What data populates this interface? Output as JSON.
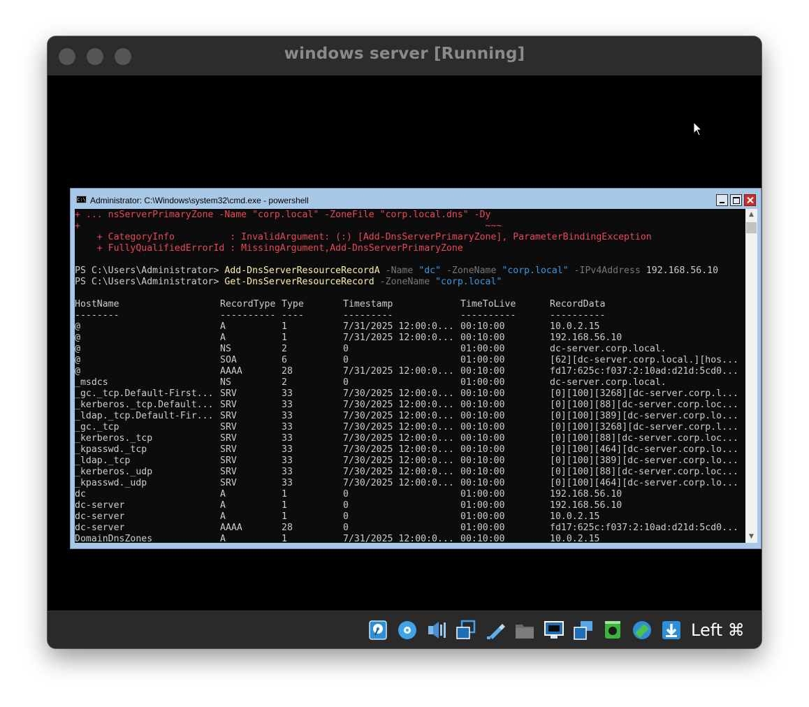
{
  "window": {
    "title": "windows server [Running]"
  },
  "cmd": {
    "title": "Administrator: C:\\Windows\\system32\\cmd.exe - powershell",
    "icon_text": "C:\\"
  },
  "console": {
    "error_line_1": "+ ... nsServerPrimaryZone -Name \"corp.local\" -ZoneFile \"corp.local.dns\" -Dy",
    "error_line_2": "+                                                                         ~~~",
    "error_line_3": "    + CategoryInfo          : InvalidArgument: (:) [Add-DnsServerPrimaryZone], ParameterBindingException",
    "error_line_4": "    + FullyQualifiedErrorId : MissingArgument,Add-DnsServerPrimaryZone",
    "prompt1": {
      "prompt": "PS C:\\Users\\Administrator> ",
      "cmdlet": "Add-DnsServerResourceRecordA",
      "p1": " -Name",
      "v1": " \"dc\"",
      "p2": " -ZoneName",
      "v2": " \"corp.local\"",
      "p3": " -IPv4Address",
      "v3": " 192.168.56.10"
    },
    "prompt2": {
      "prompt": "PS C:\\Users\\Administrator> ",
      "cmdlet": "Get-DnsServerResourceRecord",
      "p1": " -ZoneName",
      "v1": " \"corp.local\""
    },
    "headers": [
      "HostName",
      "RecordType",
      "Type",
      "Timestamp",
      "TimeToLive",
      "RecordData"
    ],
    "separators": [
      "--------",
      "----------",
      "----",
      "---------",
      "----------",
      "----------"
    ],
    "rows": [
      [
        "@",
        "A",
        "1",
        "7/31/2025 12:00:0...",
        "00:10:00",
        "10.0.2.15"
      ],
      [
        "@",
        "A",
        "1",
        "7/31/2025 12:00:0...",
        "00:10:00",
        "192.168.56.10"
      ],
      [
        "@",
        "NS",
        "2",
        "0",
        "01:00:00",
        "dc-server.corp.local."
      ],
      [
        "@",
        "SOA",
        "6",
        "0",
        "01:00:00",
        "[62][dc-server.corp.local.][hos..."
      ],
      [
        "@",
        "AAAA",
        "28",
        "7/31/2025 12:00:0...",
        "00:10:00",
        "fd17:625c:f037:2:10ad:d21d:5cd0..."
      ],
      [
        "_msdcs",
        "NS",
        "2",
        "0",
        "01:00:00",
        "dc-server.corp.local."
      ],
      [
        "_gc._tcp.Default-First...",
        "SRV",
        "33",
        "7/30/2025 12:00:0...",
        "00:10:00",
        "[0][100][3268][dc-server.corp.l..."
      ],
      [
        "_kerberos._tcp.Default...",
        "SRV",
        "33",
        "7/30/2025 12:00:0...",
        "00:10:00",
        "[0][100][88][dc-server.corp.loc..."
      ],
      [
        "_ldap._tcp.Default-Fir...",
        "SRV",
        "33",
        "7/30/2025 12:00:0...",
        "00:10:00",
        "[0][100][389][dc-server.corp.lo..."
      ],
      [
        "_gc._tcp",
        "SRV",
        "33",
        "7/30/2025 12:00:0...",
        "00:10:00",
        "[0][100][3268][dc-server.corp.l..."
      ],
      [
        "_kerberos._tcp",
        "SRV",
        "33",
        "7/30/2025 12:00:0...",
        "00:10:00",
        "[0][100][88][dc-server.corp.loc..."
      ],
      [
        "_kpasswd._tcp",
        "SRV",
        "33",
        "7/30/2025 12:00:0...",
        "00:10:00",
        "[0][100][464][dc-server.corp.lo..."
      ],
      [
        "_ldap._tcp",
        "SRV",
        "33",
        "7/30/2025 12:00:0...",
        "00:10:00",
        "[0][100][389][dc-server.corp.lo..."
      ],
      [
        "_kerberos._udp",
        "SRV",
        "33",
        "7/30/2025 12:00:0...",
        "00:10:00",
        "[0][100][88][dc-server.corp.loc..."
      ],
      [
        "_kpasswd._udp",
        "SRV",
        "33",
        "7/30/2025 12:00:0...",
        "00:10:00",
        "[0][100][464][dc-server.corp.lo..."
      ],
      [
        "dc",
        "A",
        "1",
        "0",
        "01:00:00",
        "192.168.56.10"
      ],
      [
        "dc-server",
        "A",
        "1",
        "0",
        "01:00:00",
        "192.168.56.10"
      ],
      [
        "dc-server",
        "A",
        "1",
        "0",
        "01:00:00",
        "10.0.2.15"
      ],
      [
        "dc-server",
        "AAAA",
        "28",
        "0",
        "01:00:00",
        "fd17:625c:f037:2:10ad:d21d:5cd0..."
      ],
      [
        "DomainDnsZones",
        "A",
        "1",
        "7/31/2025 12:00:0...",
        "00:10:00",
        "10.0.2.15"
      ]
    ]
  },
  "scrollbar": {
    "up": "▲",
    "down": "▼"
  },
  "statusbar": {
    "icons": [
      "hard-disk-icon",
      "optical-drive-icon",
      "audio-icon",
      "network-icon",
      "usb-icon",
      "shared-folder-icon",
      "display-icon",
      "clipboard-icon",
      "recording-icon",
      "mouse-integration-icon",
      "download-icon"
    ],
    "host_key": "Left ⌘"
  }
}
